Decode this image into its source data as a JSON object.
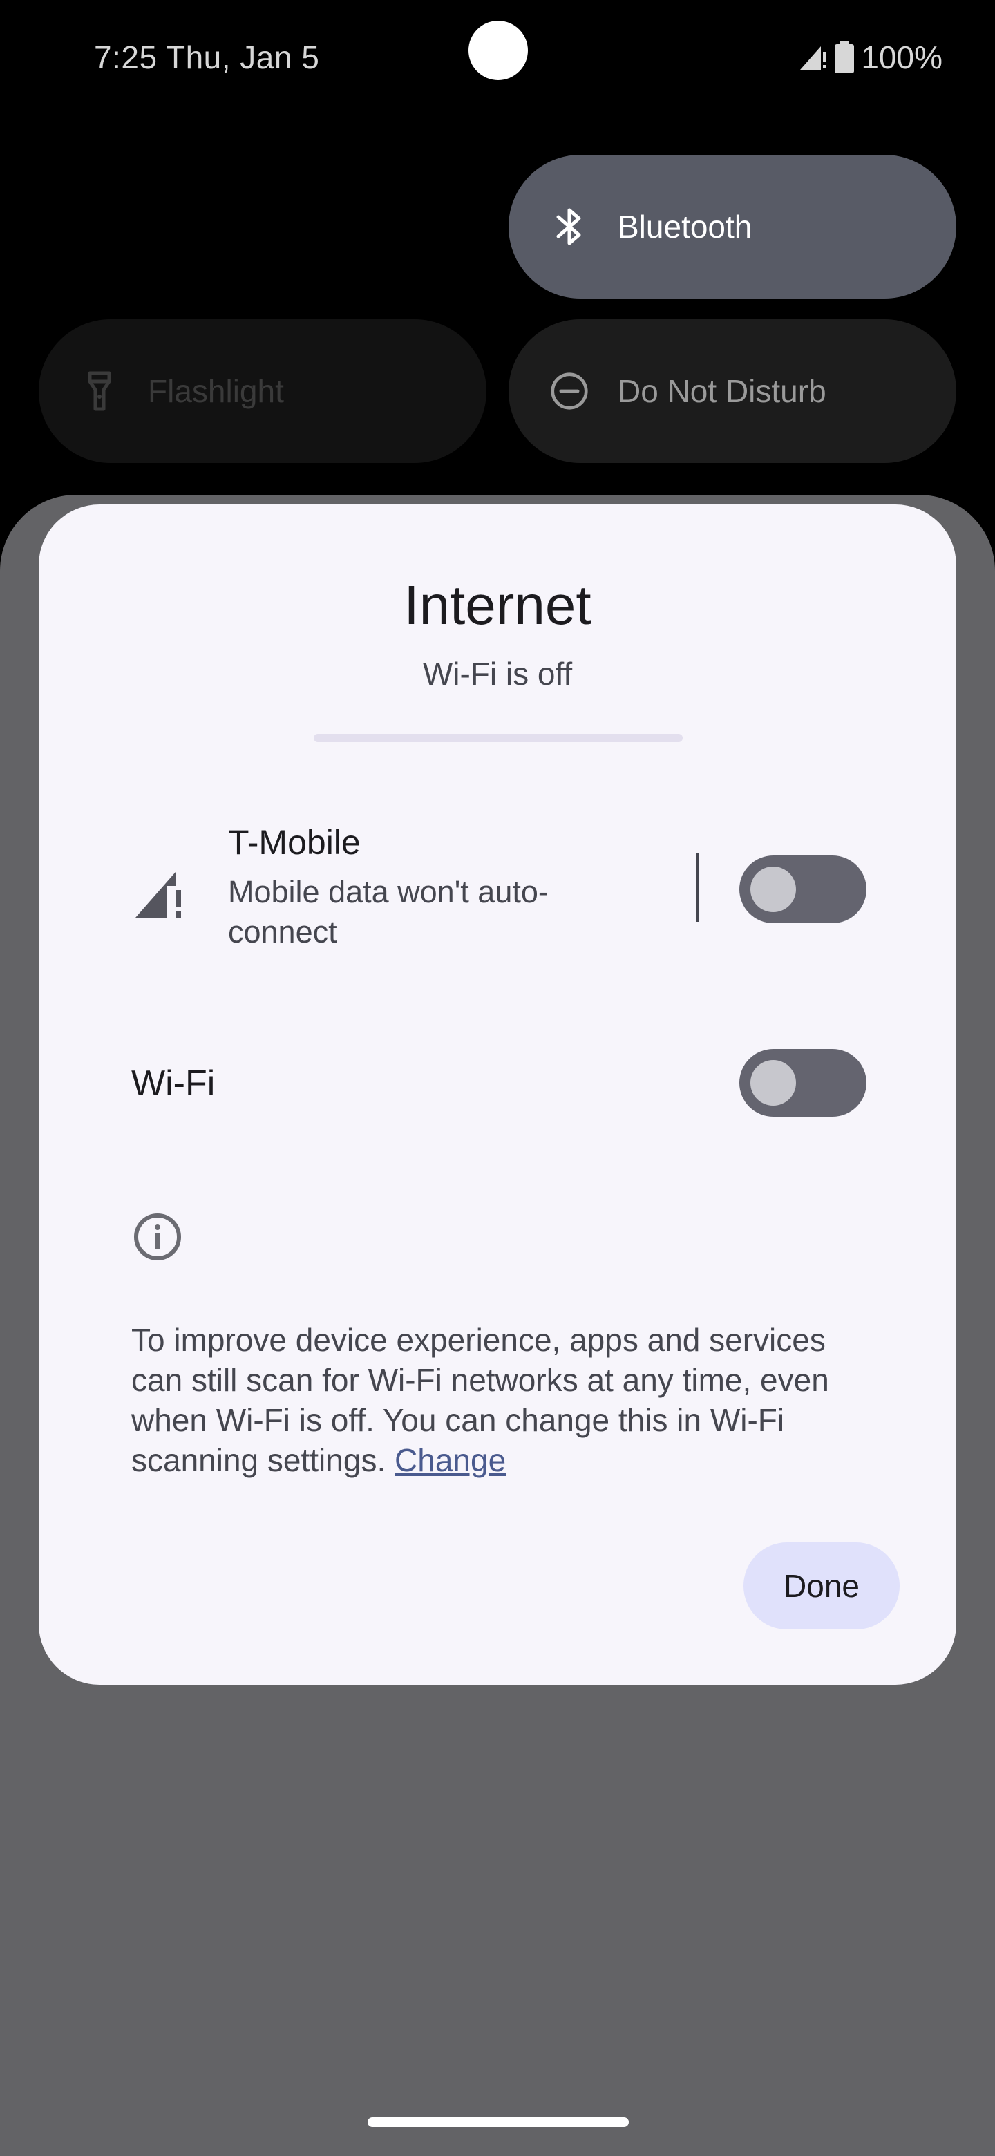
{
  "status_bar": {
    "time": "7:25 Thu, Jan 5",
    "battery": "100%",
    "icons": [
      "signal-no-data-icon",
      "battery-icon"
    ]
  },
  "quick_settings": {
    "tiles": [
      {
        "label": "Bluetooth",
        "icon": "bluetooth-icon",
        "state": "on"
      },
      {
        "label": "Flashlight",
        "icon": "flashlight-icon",
        "state": "unavailable"
      },
      {
        "label": "Do Not Disturb",
        "icon": "do-not-disturb-icon",
        "state": "off"
      }
    ]
  },
  "dialog": {
    "title": "Internet",
    "subtitle": "Wi-Fi is off",
    "mobile": {
      "name": "T-Mobile",
      "description": "Mobile data won't auto-connect",
      "toggle_on": false
    },
    "wifi": {
      "label": "Wi-Fi",
      "toggle_on": false
    },
    "info_text": "To improve device experience, apps and services can still scan for Wi-Fi networks at any time, even when Wi-Fi is off. You can change this in Wi-Fi scanning settings.",
    "info_link": "Change",
    "done_label": "Done"
  },
  "colors": {
    "dialog_bg": "#f7f5fb",
    "toggle_off": "#64646f",
    "done_bg": "#e0e1fb",
    "link": "#4a5a8e",
    "scrim": "#636366"
  }
}
